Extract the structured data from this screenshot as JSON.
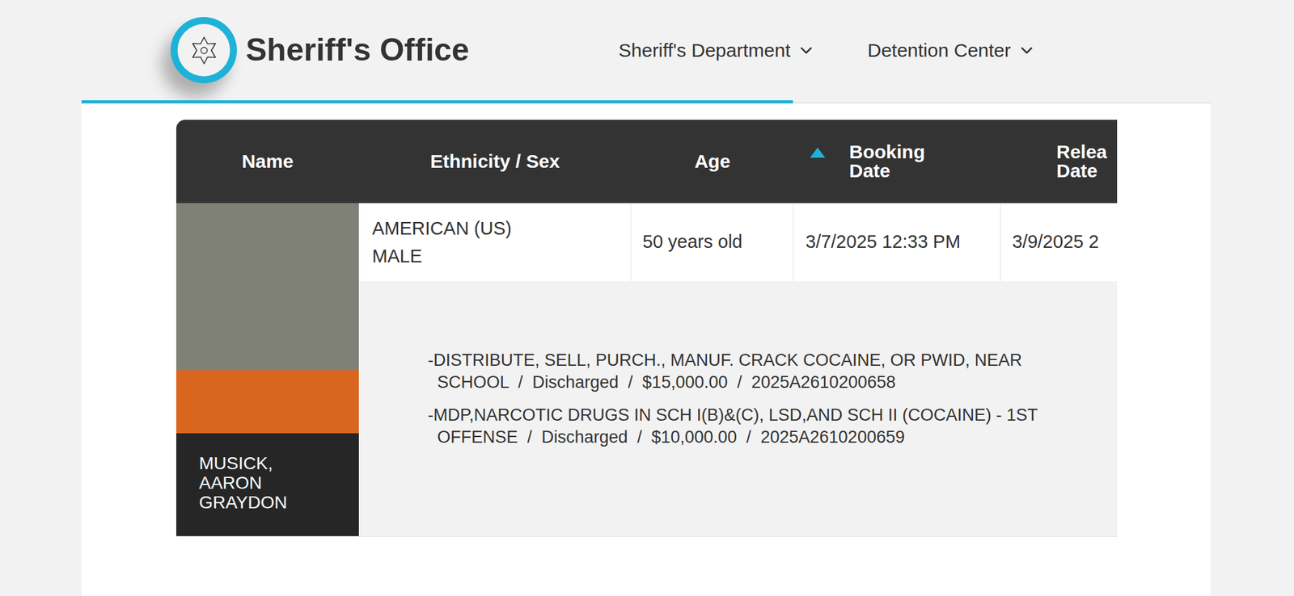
{
  "header": {
    "title": "Sheriff's Office",
    "nav": [
      {
        "label": "Sheriff's Department",
        "expanded": false
      },
      {
        "label": "Detention Center",
        "expanded": false
      }
    ]
  },
  "table": {
    "columns": [
      {
        "label": [
          "Name"
        ],
        "sorted": false
      },
      {
        "label": [
          "Ethnicity / Sex"
        ],
        "sorted": false
      },
      {
        "label": [
          "Age"
        ],
        "sorted": false
      },
      {
        "label": [
          "Booking",
          "Date"
        ],
        "sorted": true,
        "sort_direction": "asc"
      },
      {
        "label": [
          "Relea",
          "Date"
        ],
        "sorted": false
      }
    ],
    "rows": [
      {
        "name": "MUSICK, AARON GRAYDON",
        "ethnicity": "AMERICAN (US)",
        "sex": "MALE",
        "age": "50 years old",
        "booking_date": "3/7/2025 12:33 PM",
        "release_date": "3/9/2025 2",
        "charges": [
          {
            "lines": [
              "-DISTRIBUTE, SELL, PURCH., MANUF. CRACK COCAINE, OR PWID, NEAR",
              "SCHOOL  /  Discharged  /  $15,000.00  /  2025A2610200658"
            ]
          },
          {
            "lines": [
              "-MDP,NARCOTIC DRUGS IN SCH I(B)&(C), LSD,AND SCH II (COCAINE) - 1ST",
              "OFFENSE  /  Discharged  /  $10,000.00  /  2025A2610200659"
            ]
          }
        ]
      }
    ]
  }
}
